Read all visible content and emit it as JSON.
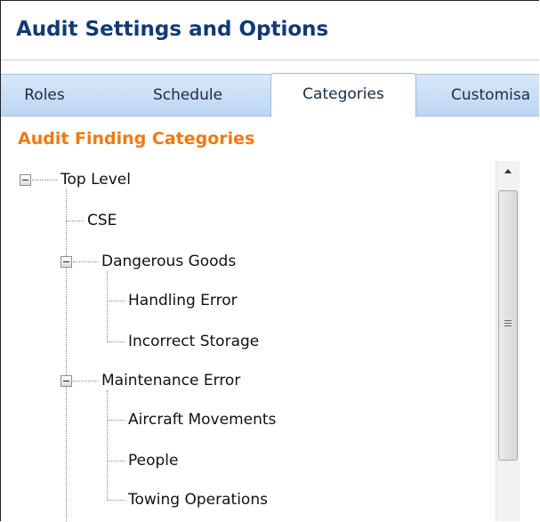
{
  "header": {
    "title": "Audit Settings and Options"
  },
  "tabs": [
    {
      "label": "Roles",
      "active": false
    },
    {
      "label": "Schedule",
      "active": false
    },
    {
      "label": "Categories",
      "active": true
    },
    {
      "label": "Customisa",
      "active": false
    }
  ],
  "section": {
    "title": "Audit Finding Categories"
  },
  "tree": {
    "root": {
      "label": "Top Level",
      "expanded": true
    },
    "cse": {
      "label": "CSE"
    },
    "dangerous_goods": {
      "label": "Dangerous Goods",
      "expanded": true,
      "children": [
        "Handling Error",
        "Incorrect Storage"
      ]
    },
    "maintenance_error": {
      "label": "Maintenance Error",
      "expanded": true,
      "children": [
        "Aircraft Movements",
        "People",
        "Towing Operations"
      ]
    }
  },
  "colors": {
    "title": "#123a75",
    "section_title": "#ef7a12",
    "tab_strip": "#c9def5"
  }
}
